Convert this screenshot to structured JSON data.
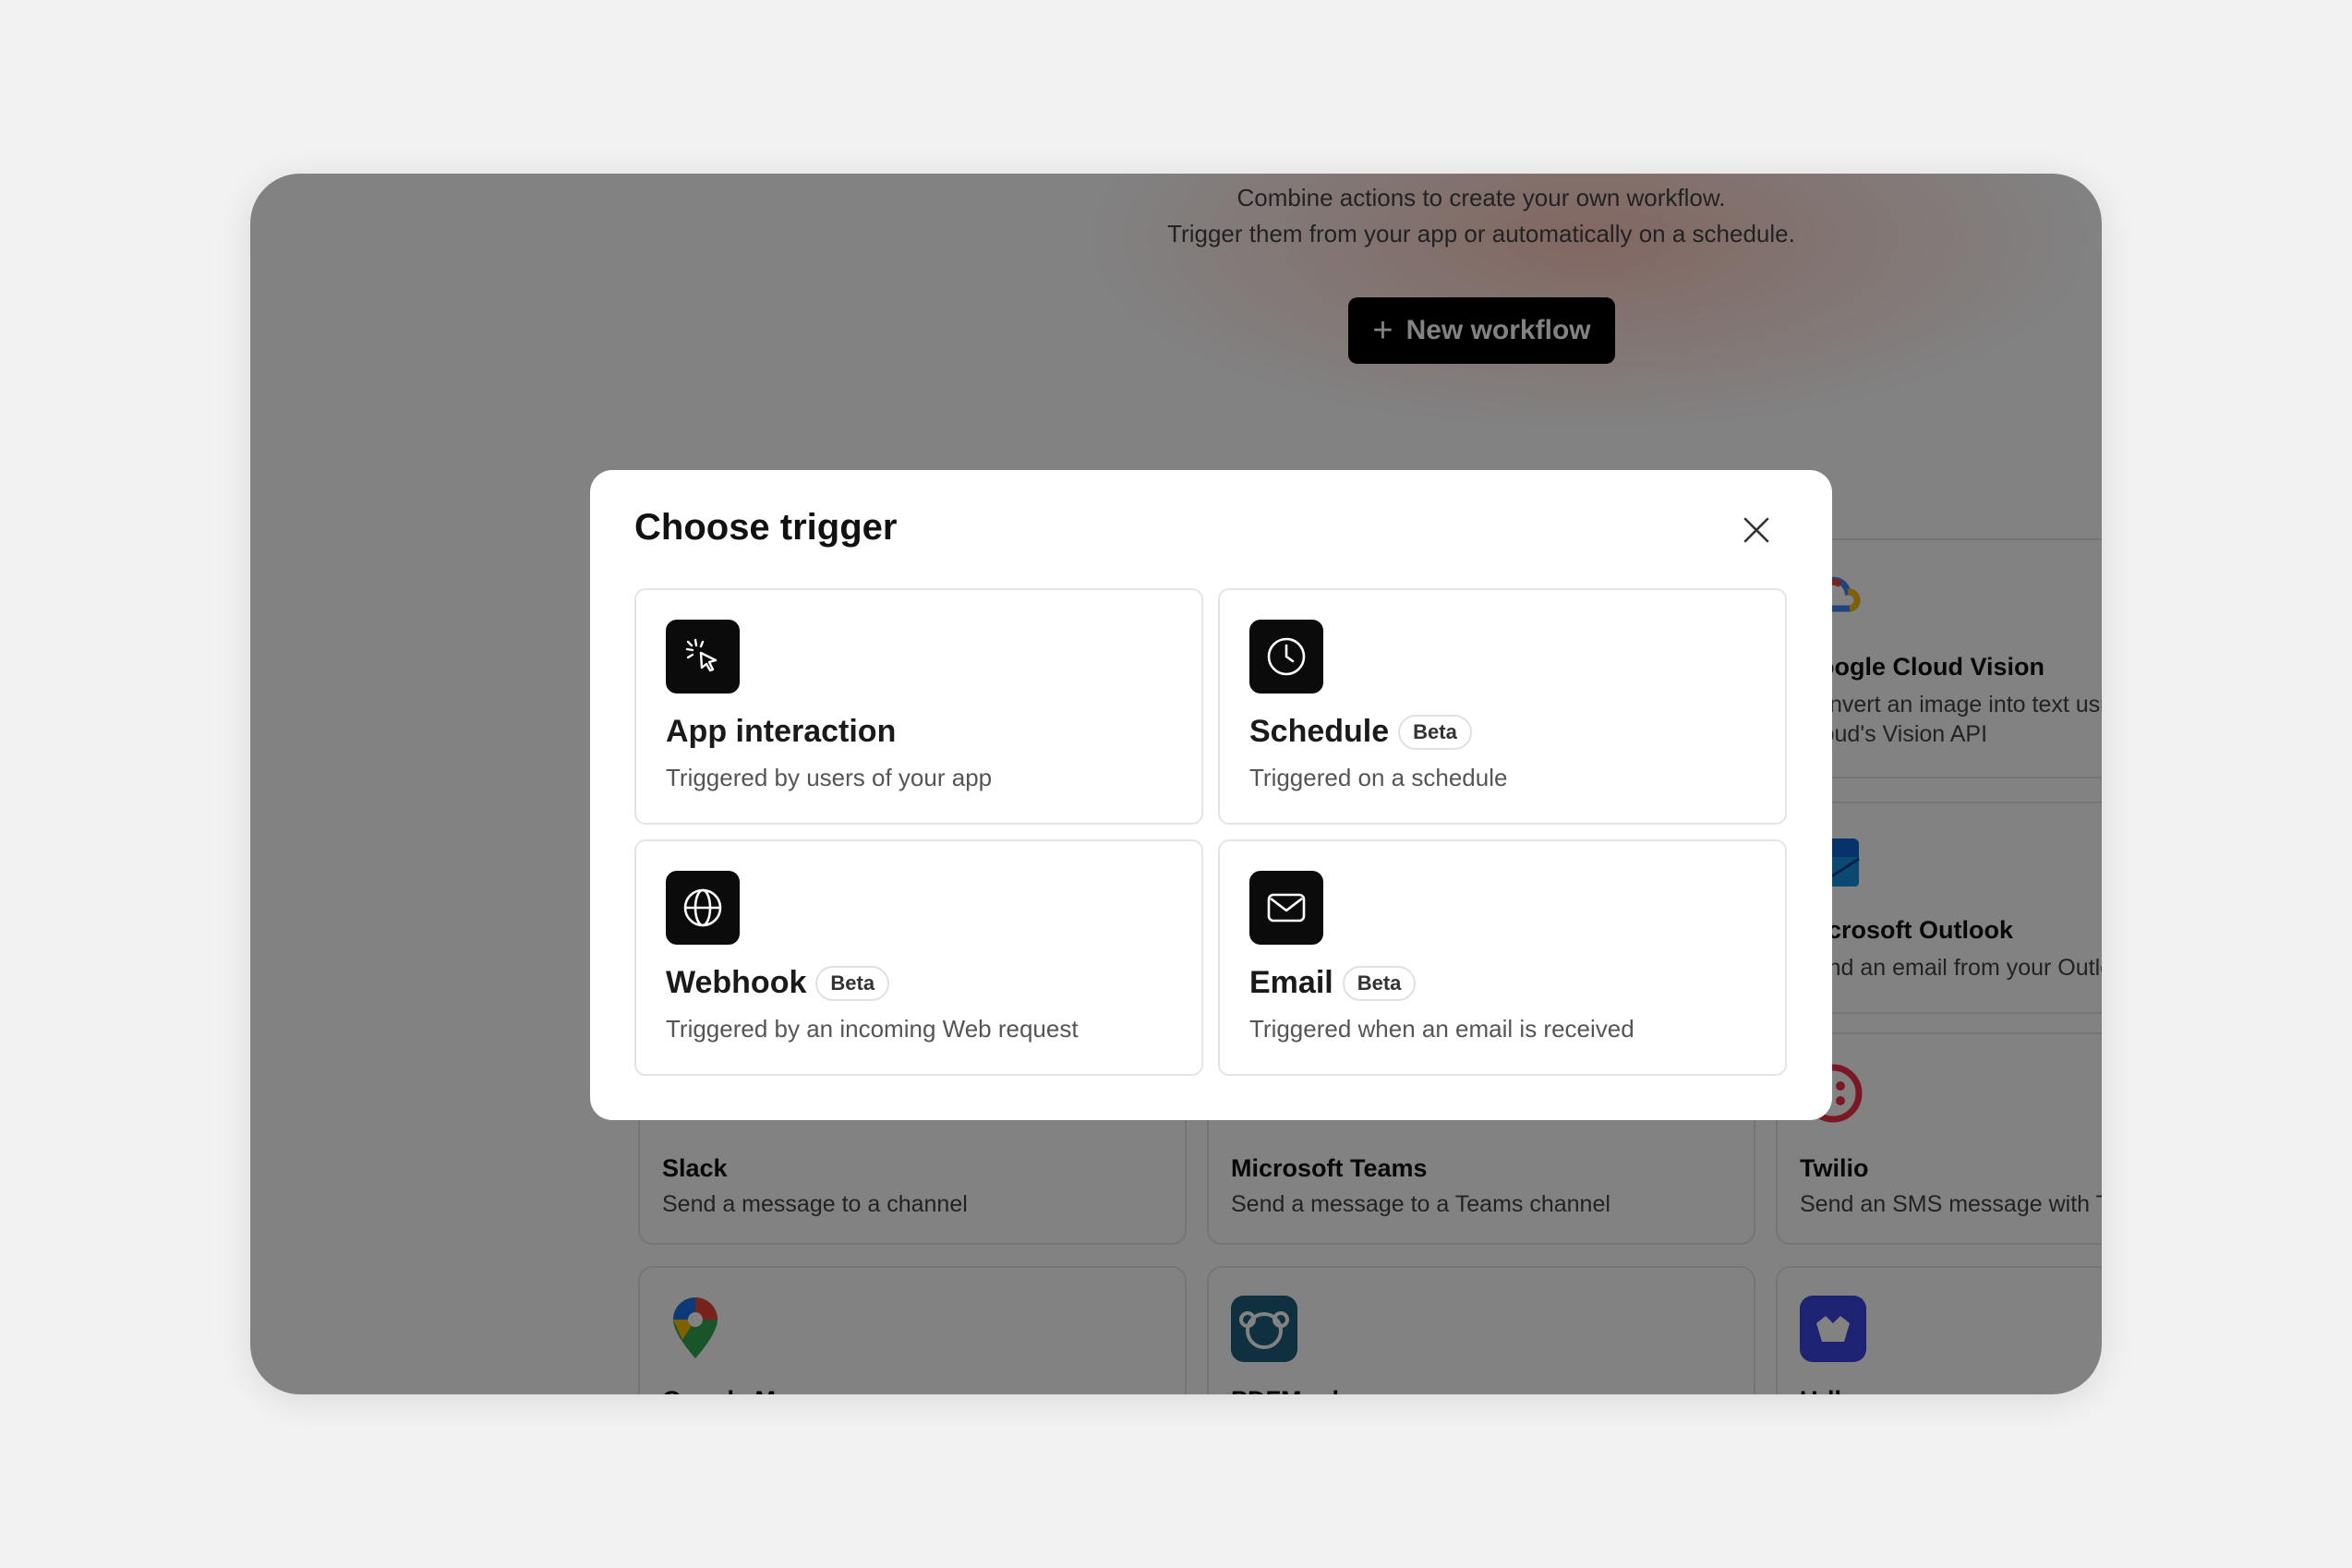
{
  "hero": {
    "line1": "Combine actions to create your own workflow.",
    "line2": "Trigger them from your app or automatically on a schedule.",
    "new_workflow_label": "New workflow"
  },
  "integrations": [
    {
      "name": "Google Cloud Vision",
      "desc_line1": "Convert an image into text using Google",
      "desc_line2": "Cloud's Vision API",
      "icon": "google-cloud-icon"
    },
    {
      "name": "Microsoft Outlook",
      "desc_line1": "Send an email from your Outlook account",
      "desc_line2": "",
      "icon": "outlook-icon"
    },
    {
      "name": "Slack",
      "desc_line1": "Send a message to a channel",
      "desc_line2": "",
      "icon": "slack-icon"
    },
    {
      "name": "Microsoft Teams",
      "desc_line1": "Send a message to a Teams channel",
      "desc_line2": "",
      "icon": "teams-icon"
    },
    {
      "name": "Twilio",
      "desc_line1": "Send an SMS message with Twilio",
      "desc_line2": "",
      "icon": "twilio-icon"
    },
    {
      "name": "Google Maps",
      "desc_line1": "",
      "desc_line2": "",
      "icon": "google-maps-icon"
    },
    {
      "name": "PDFMonkey",
      "desc_line1": "",
      "desc_line2": "",
      "icon": "pdfmonkey-icon"
    },
    {
      "name": "Urlbox",
      "desc_line1": "",
      "desc_line2": "",
      "icon": "urlbox-icon"
    }
  ],
  "modal": {
    "title": "Choose trigger",
    "close_icon": "close-icon",
    "triggers": [
      {
        "name": "App interaction",
        "desc": "Triggered by users of your app",
        "badge": "",
        "icon": "cursor-click-icon"
      },
      {
        "name": "Schedule",
        "desc": "Triggered on a schedule",
        "badge": "Beta",
        "icon": "clock-icon"
      },
      {
        "name": "Webhook",
        "desc": "Triggered by an incoming Web request",
        "badge": "Beta",
        "icon": "globe-icon"
      },
      {
        "name": "Email",
        "desc": "Triggered when an email is received",
        "badge": "Beta",
        "icon": "mail-icon"
      }
    ]
  },
  "colors": {
    "overlay": "#00000080",
    "button_bg": "#000000",
    "icon_tile": "#0b0b0b"
  }
}
